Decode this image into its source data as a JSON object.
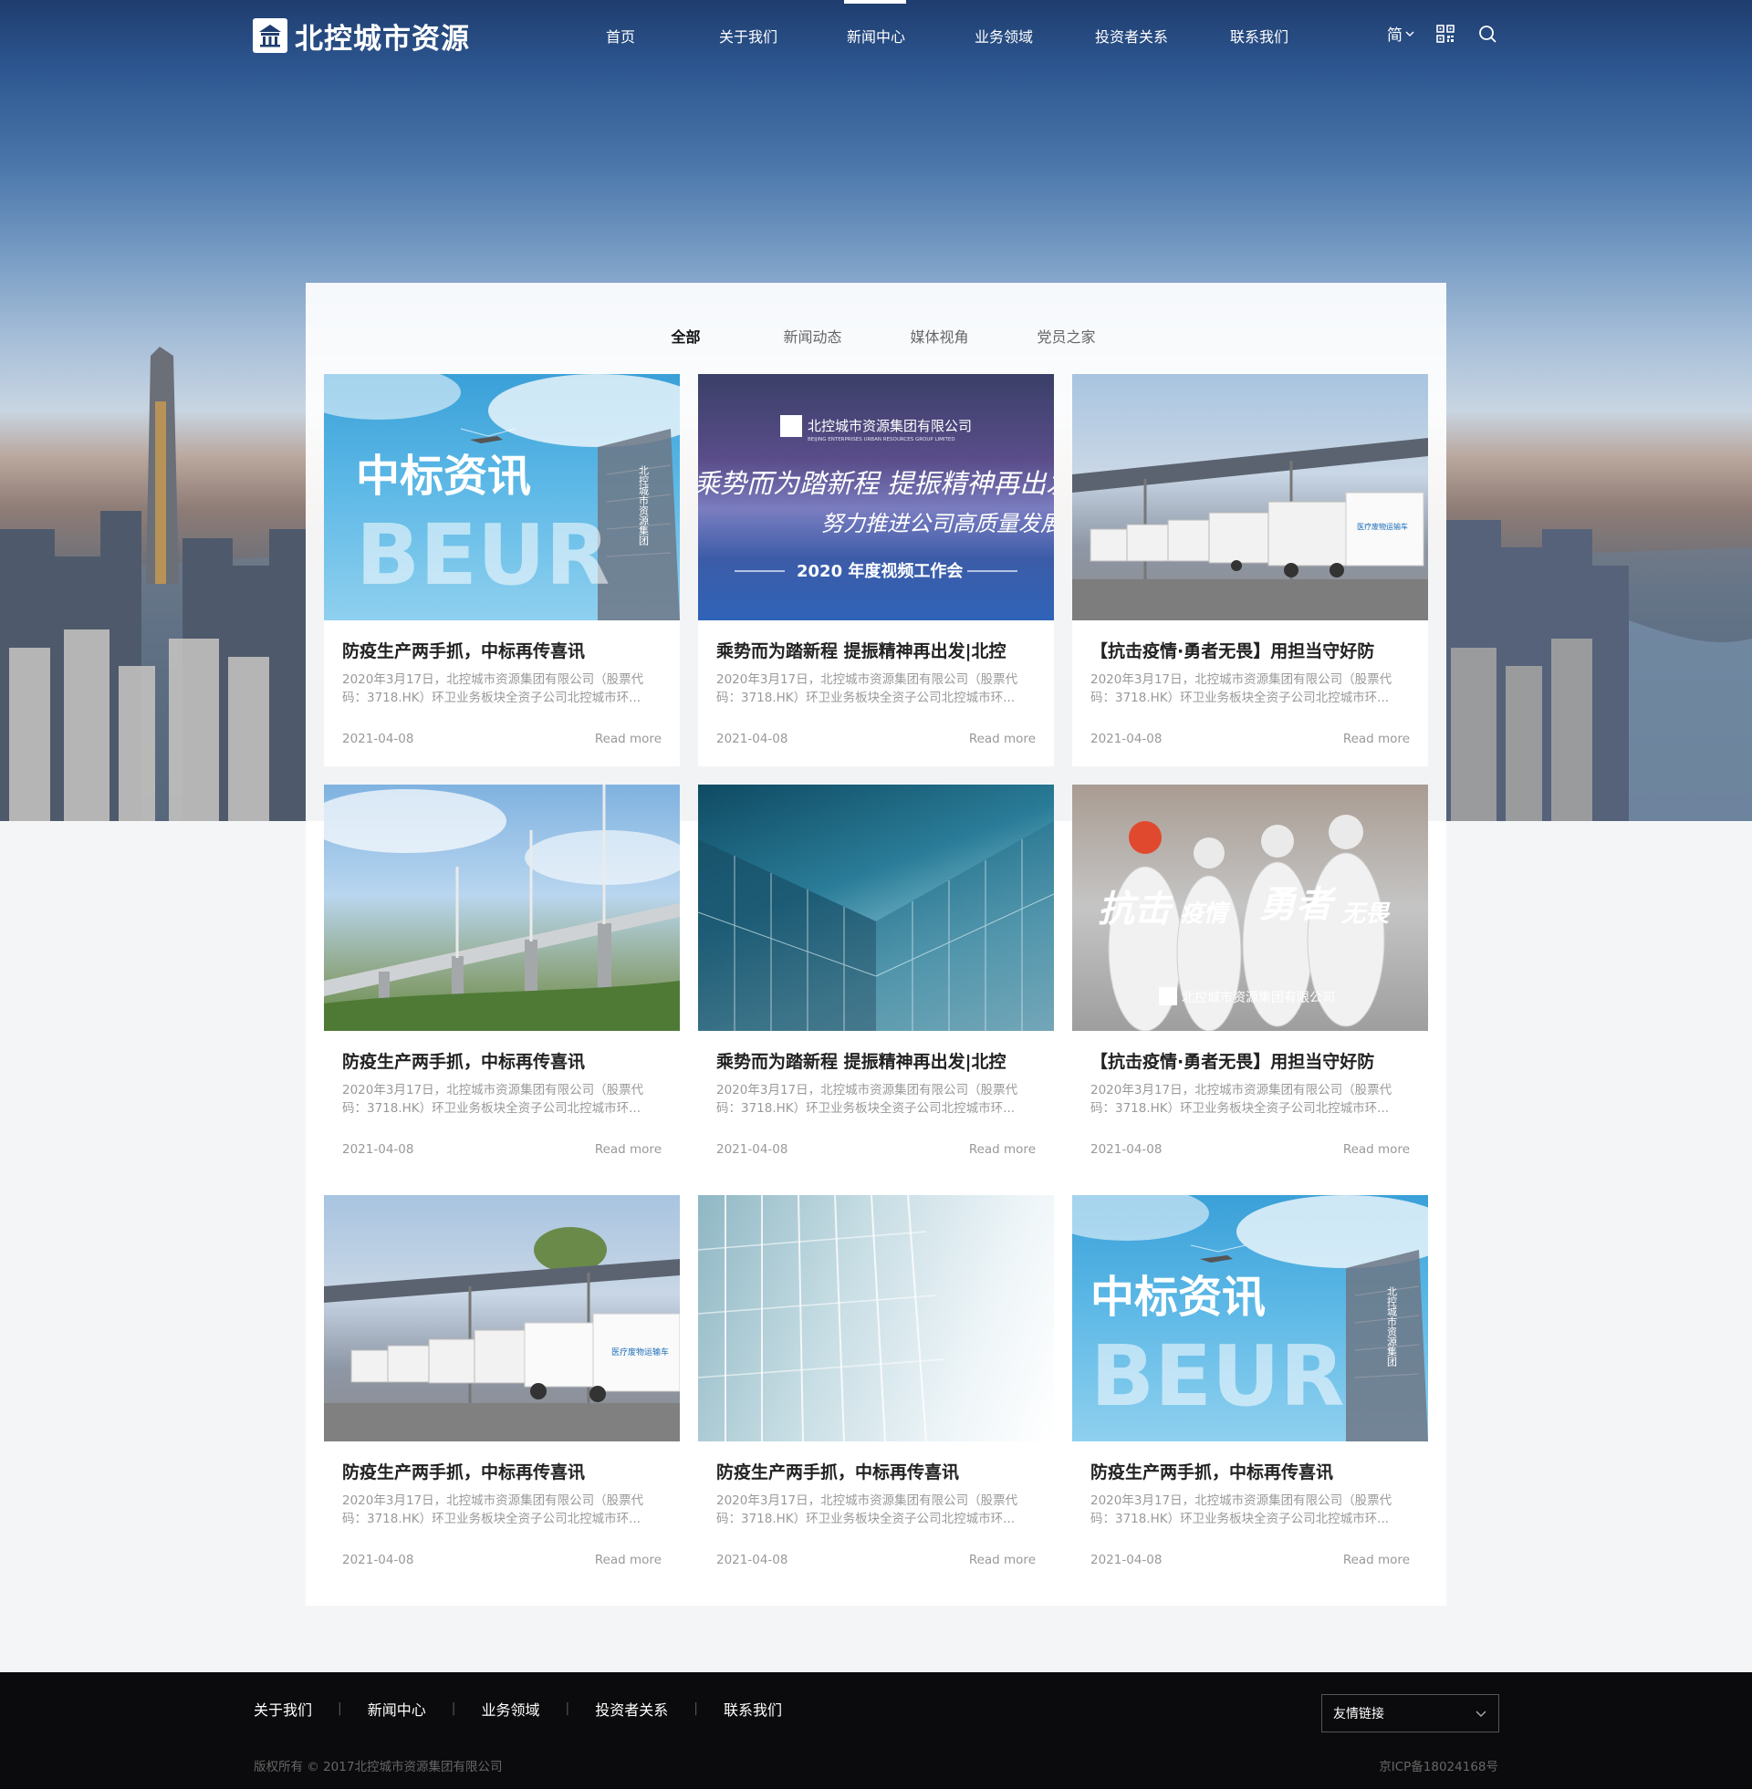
{
  "brand": {
    "name": "北控城市资源"
  },
  "nav": {
    "items": [
      {
        "label": "首页"
      },
      {
        "label": "关于我们"
      },
      {
        "label": "新闻中心"
      },
      {
        "label": "业务领域"
      },
      {
        "label": "投资者关系"
      },
      {
        "label": "联系我们"
      }
    ],
    "active_index": 2,
    "lang_label": "简"
  },
  "tabs": [
    {
      "label": "全部"
    },
    {
      "label": "新闻动态"
    },
    {
      "label": "媒体视角"
    },
    {
      "label": "党员之家"
    }
  ],
  "image_texts": {
    "bid_title": "中标资讯",
    "bid_sub": "BEUR",
    "bid_vertical": "北控城市资源集团",
    "banner_company": "北控城市资源集团有限公司",
    "banner_company_en": "BEIJING ENTERPRISES URBAN RESOURCES GROUP LIMITED",
    "banner_line1": "乘势而为踏新程 提振精神再出发",
    "banner_line2": "努力推进公司高质量发展",
    "banner_line3": "2020 年度视频工作会",
    "truck_label": "医疗废物运输车",
    "ppe_slogan_a": "抗击",
    "ppe_slogan_b": "疫情",
    "ppe_slogan_c": "勇者",
    "ppe_slogan_d": "无畏",
    "ppe_company": "北控城市资源集团有限公司"
  },
  "cards": [
    {
      "image": "bid",
      "title": "防疫生产两手抓，中标再传喜讯",
      "desc": "2020年3月17日，北控城市资源集团有限公司（股票代码：3718.HK）环卫业务板块全资子公司北控城市环...",
      "date": "2021-04-08",
      "more": "Read more"
    },
    {
      "image": "banner",
      "title": "乘势而为踏新程 提振精神再出发|北控",
      "desc": "2020年3月17日，北控城市资源集团有限公司（股票代码：3718.HK）环卫业务板块全资子公司北控城市环...",
      "date": "2021-04-08",
      "more": "Read more"
    },
    {
      "image": "trucks",
      "title": "【抗击疫情·勇者无畏】用担当守好防",
      "desc": "2020年3月17日，北控城市资源集团有限公司（股票代码：3718.HK）环卫业务板块全资子公司北控城市环...",
      "date": "2021-04-08",
      "more": "Read more"
    },
    {
      "image": "bridge",
      "title": "防疫生产两手抓，中标再传喜讯",
      "desc": "2020年3月17日，北控城市资源集团有限公司（股票代码：3718.HK）环卫业务板块全资子公司北控城市环...",
      "date": "2021-04-08",
      "more": "Read more"
    },
    {
      "image": "glass",
      "title": "乘势而为踏新程 提振精神再出发|北控",
      "desc": "2020年3月17日，北控城市资源集团有限公司（股票代码：3718.HK）环卫业务板块全资子公司北控城市环...",
      "date": "2021-04-08",
      "more": "Read more"
    },
    {
      "image": "ppe",
      "title": "【抗击疫情·勇者无畏】用担当守好防",
      "desc": "2020年3月17日，北控城市资源集团有限公司（股票代码：3718.HK）环卫业务板块全资子公司北控城市环...",
      "date": "2021-04-08",
      "more": "Read more"
    },
    {
      "image": "trucks",
      "title": "防疫生产两手抓，中标再传喜讯",
      "desc": "2020年3月17日，北控城市资源集团有限公司（股票代码：3718.HK）环卫业务板块全资子公司北控城市环...",
      "date": "2021-04-08",
      "more": "Read more"
    },
    {
      "image": "glass-light",
      "title": "防疫生产两手抓，中标再传喜讯",
      "desc": "2020年3月17日，北控城市资源集团有限公司（股票代码：3718.HK）环卫业务板块全资子公司北控城市环...",
      "date": "2021-04-08",
      "more": "Read more"
    },
    {
      "image": "bid",
      "title": "防疫生产两手抓，中标再传喜讯",
      "desc": "2020年3月17日，北控城市资源集团有限公司（股票代码：3718.HK）环卫业务板块全资子公司北控城市环...",
      "date": "2021-04-08",
      "more": "Read more"
    }
  ],
  "footer": {
    "links": [
      {
        "label": "关于我们"
      },
      {
        "label": "新闻中心"
      },
      {
        "label": "业务领域"
      },
      {
        "label": "投资者关系"
      },
      {
        "label": "联系我们"
      }
    ],
    "friend_links_label": "友情链接",
    "copyright": "版权所有 © 2017北控城市资源集团有限公司",
    "icp": "京ICP备18024168号"
  },
  "icons": {
    "qr": "qr-code-icon",
    "search": "search-icon",
    "chevron": "chevron-down-icon"
  },
  "colors": {
    "footer_bg": "#0b0b0d",
    "accent_white": "#ffffff",
    "muted_text": "#999999"
  }
}
